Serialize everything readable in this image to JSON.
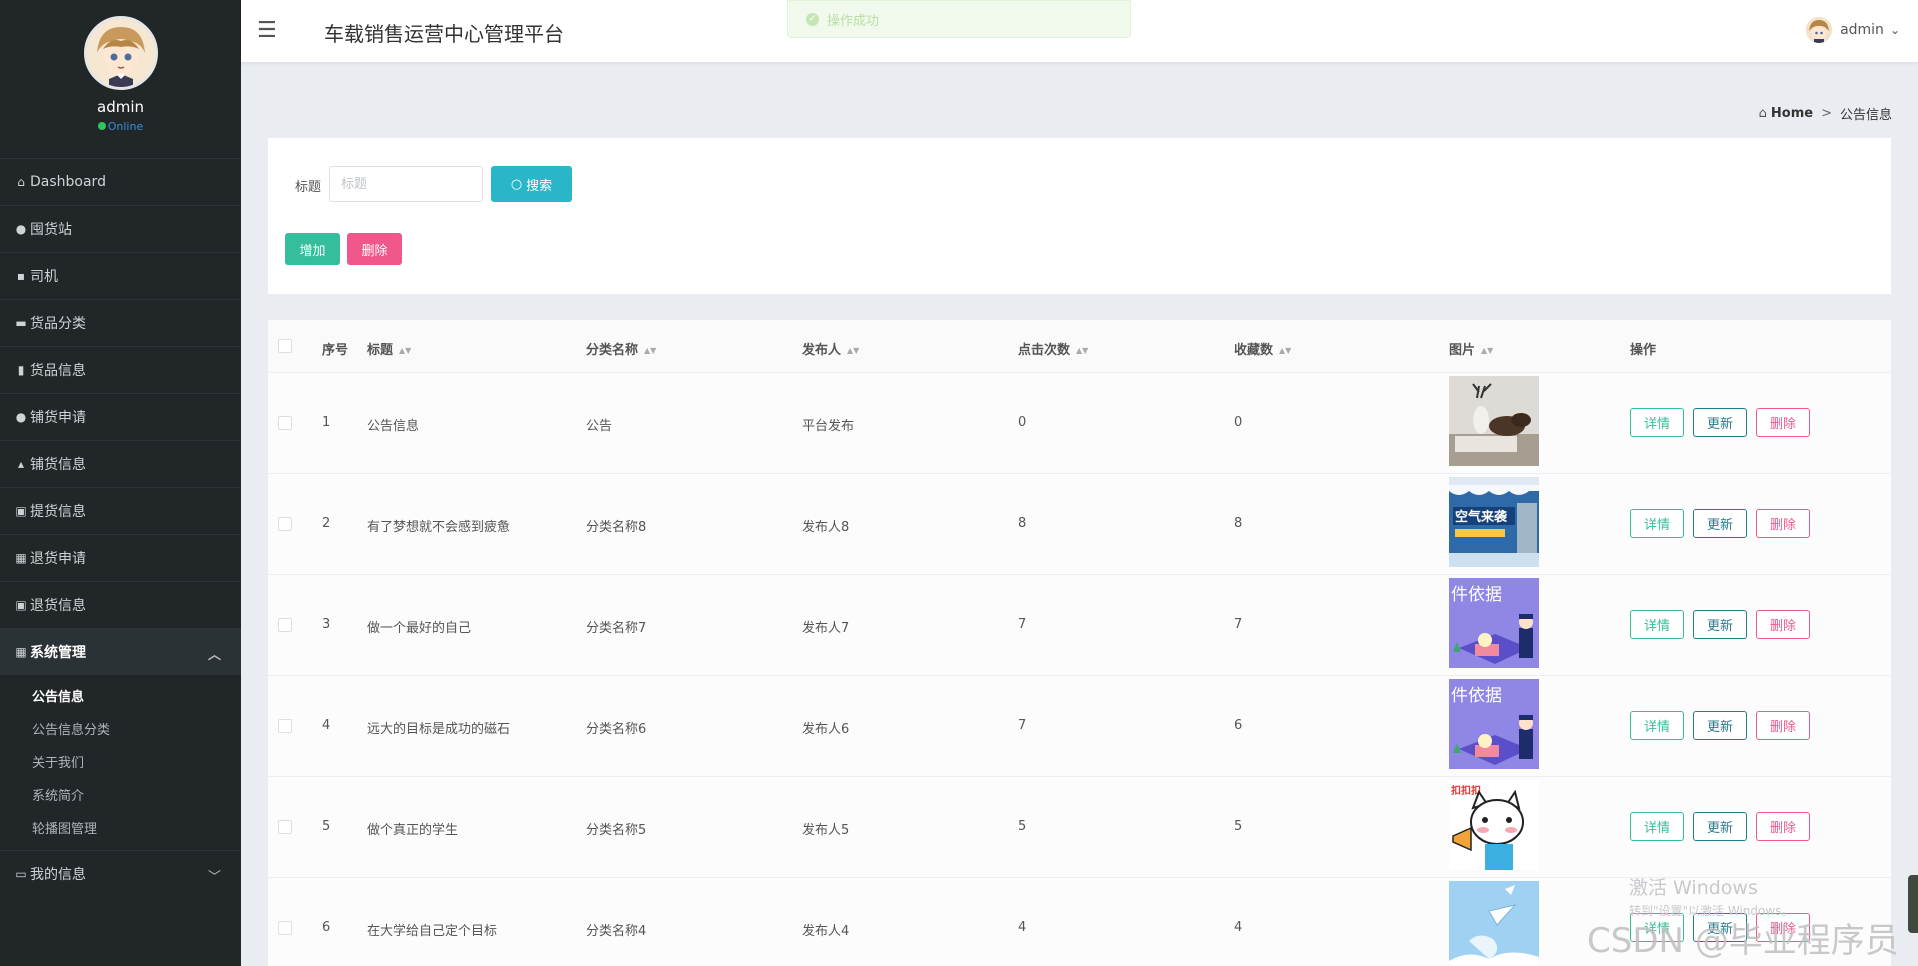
{
  "app": {
    "title": "车载销售运营中心管理平台"
  },
  "toast": {
    "text": "操作成功"
  },
  "user": {
    "name": "admin",
    "status": "Online"
  },
  "sidebar": {
    "items": [
      {
        "label": "Dashboard",
        "icon": "home-icon"
      },
      {
        "label": "囤货站",
        "icon": "map-pin-icon"
      },
      {
        "label": "司机",
        "icon": "chat-icon"
      },
      {
        "label": "货品分类",
        "icon": "folder-icon"
      },
      {
        "label": "货品信息",
        "icon": "chart-icon"
      },
      {
        "label": "铺货申请",
        "icon": "user-icon"
      },
      {
        "label": "铺货信息",
        "icon": "stamp-icon"
      },
      {
        "label": "提货信息",
        "icon": "clipboard-icon"
      },
      {
        "label": "退货申请",
        "icon": "grid-icon"
      },
      {
        "label": "退货信息",
        "icon": "clipboard-icon"
      }
    ],
    "system": {
      "label": "系统管理",
      "icon": "grid-icon",
      "children": [
        "公告信息",
        "公告信息分类",
        "关于我们",
        "系统简介",
        "轮播图管理"
      ]
    },
    "my_info": {
      "label": "我的信息",
      "icon": "id-card-icon"
    }
  },
  "breadcrumb": {
    "home": "Home",
    "separator": ">",
    "current": "公告信息"
  },
  "search": {
    "label": "标题",
    "placeholder": "标题",
    "button": "搜索"
  },
  "actions": {
    "add": "增加",
    "delete": "删除"
  },
  "table": {
    "headers": [
      "序号",
      "标题",
      "分类名称",
      "发布人",
      "点击次数",
      "收藏数",
      "图片",
      "操作"
    ],
    "rows": [
      {
        "index": "1",
        "title": "公告信息",
        "category": "公告",
        "publisher": "平台发布",
        "clicks": "0",
        "favorites": "0",
        "image": "deer-decor-image"
      },
      {
        "index": "2",
        "title": "有了梦想就不会感到疲惫",
        "category": "分类名称8",
        "publisher": "发布人8",
        "clicks": "8",
        "favorites": "8",
        "image": "winter-poster-image"
      },
      {
        "index": "3",
        "title": "做一个最好的自己",
        "category": "分类名称7",
        "publisher": "发布人7",
        "clicks": "7",
        "favorites": "7",
        "image": "police-illustration-image"
      },
      {
        "index": "4",
        "title": "远大的目标是成功的磁石",
        "category": "分类名称6",
        "publisher": "发布人6",
        "clicks": "7",
        "favorites": "6",
        "image": "police-illustration-image"
      },
      {
        "index": "5",
        "title": "做个真正的学生",
        "category": "分类名称5",
        "publisher": "发布人5",
        "clicks": "5",
        "favorites": "5",
        "image": "cartoon-cat-megaphone-image"
      },
      {
        "index": "6",
        "title": "在大学给自己定个目标",
        "category": "分类名称4",
        "publisher": "发布人4",
        "clicks": "4",
        "favorites": "4",
        "image": "sky-cartoon-image"
      }
    ],
    "op_labels": {
      "detail": "详情",
      "update": "更新",
      "delete": "删除"
    }
  },
  "thumb_text": {
    "row2": "空气来袭",
    "row3": "件依据",
    "row4": "件依据",
    "row5": "扣扣扣"
  },
  "overlay": {
    "activate_title": "激活 Windows",
    "activate_sub": "转到\"设置\"以激活 Windows。",
    "watermark": "CSDN @毕业程序员"
  },
  "colors": {
    "sidebar_bg": "#212629",
    "search_button": "#2ab6c9",
    "add_button": "#36bd9b",
    "delete_button": "#f0578a",
    "update_button": "#2a7a8c",
    "online": "#31c65a"
  }
}
